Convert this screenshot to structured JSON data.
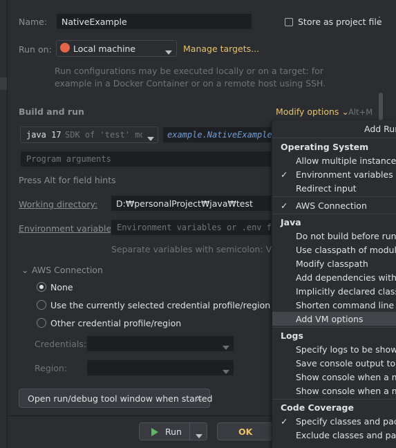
{
  "name_label": "Name:",
  "name_value": "NativeExample",
  "store_label": "Store as project file",
  "run_on_label": "Run on:",
  "run_on_value": "Local machine",
  "manage_targets": "Manage targets...",
  "run_on_help": [
    "Run configurations may be executed locally or on a target: for",
    "example in a Docker Container or on a remote host using SSH."
  ],
  "build_run_title": "Build and run",
  "modify_options": "Modify options",
  "modify_shortcut": "Alt+M",
  "sdk_name": "java 17",
  "sdk_desc": "SDK of 'test' mo",
  "main_class": "example.NativeExample",
  "program_args_placeholder": "Program arguments",
  "field_hints": "Press Alt for field hints",
  "working_dir_label": "Working directory:",
  "working_dir_value": "D:₩personalProject₩java₩test",
  "env_label": "Environment variables:",
  "env_placeholder": "Environment variables or .env fi",
  "env_help": "Separate variables with semicolon: VAR=va",
  "aws_section": "AWS Connection",
  "radio_none": "None",
  "radio_current": "Use the currently selected credential profile/region",
  "radio_other": "Other credential profile/region",
  "credentials_label": "Credentials:",
  "region_label": "Region:",
  "tag_open_window": "Open run/debug tool window when started",
  "run_button": "Run",
  "ok_button": "OK",
  "popup": {
    "add_run": "Add Run",
    "os_header": "Operating System",
    "allow_multiple": "Allow multiple instances",
    "env_vars": "Environment variables",
    "redirect_input": "Redirect input",
    "aws_connection": "AWS Connection",
    "java_header": "Java",
    "no_build": "Do not build before run",
    "use_classpath": "Use classpath of module",
    "modify_classpath": "Modify classpath",
    "add_deps": "Add dependencies with \"pr",
    "implicit": "Implicitly declared class run",
    "shorten": "Shorten command line",
    "add_vm": "Add VM options",
    "logs_header": "Logs",
    "logs_shown": "Specify logs to be shown in",
    "save_console": "Save console output to file",
    "show_console1": "Show console when a mess",
    "show_console2": "Show console when a mess",
    "coverage_header": "Code Coverage",
    "specify_classes": "Specify classes and packag",
    "exclude_classes": "Exclude classes and packag"
  },
  "colors": {
    "accent_link": "#e8c46a",
    "selection": "#43454a",
    "run_icon": "#5fb865",
    "home_icon": "#e5644a"
  }
}
